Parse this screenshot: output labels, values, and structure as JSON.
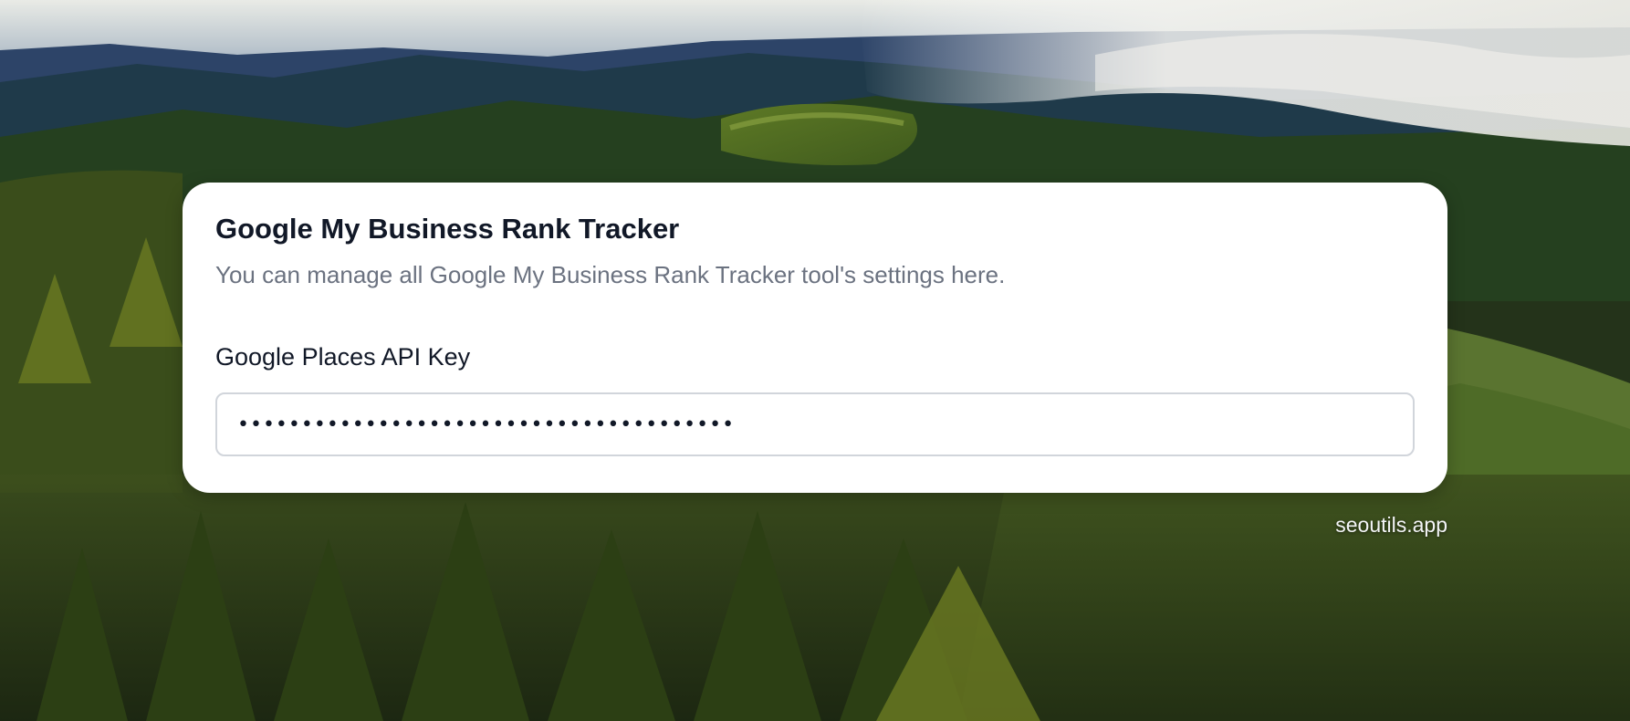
{
  "card": {
    "title": "Google My Business Rank Tracker",
    "subtitle": "You can manage all Google My Business Rank Tracker tool's settings here."
  },
  "api_key_field": {
    "label": "Google Places API Key",
    "value": "•••••••••••••••••••••••••••••••••••••••",
    "type": "password"
  },
  "footer": {
    "brand": "seoutils.app"
  }
}
